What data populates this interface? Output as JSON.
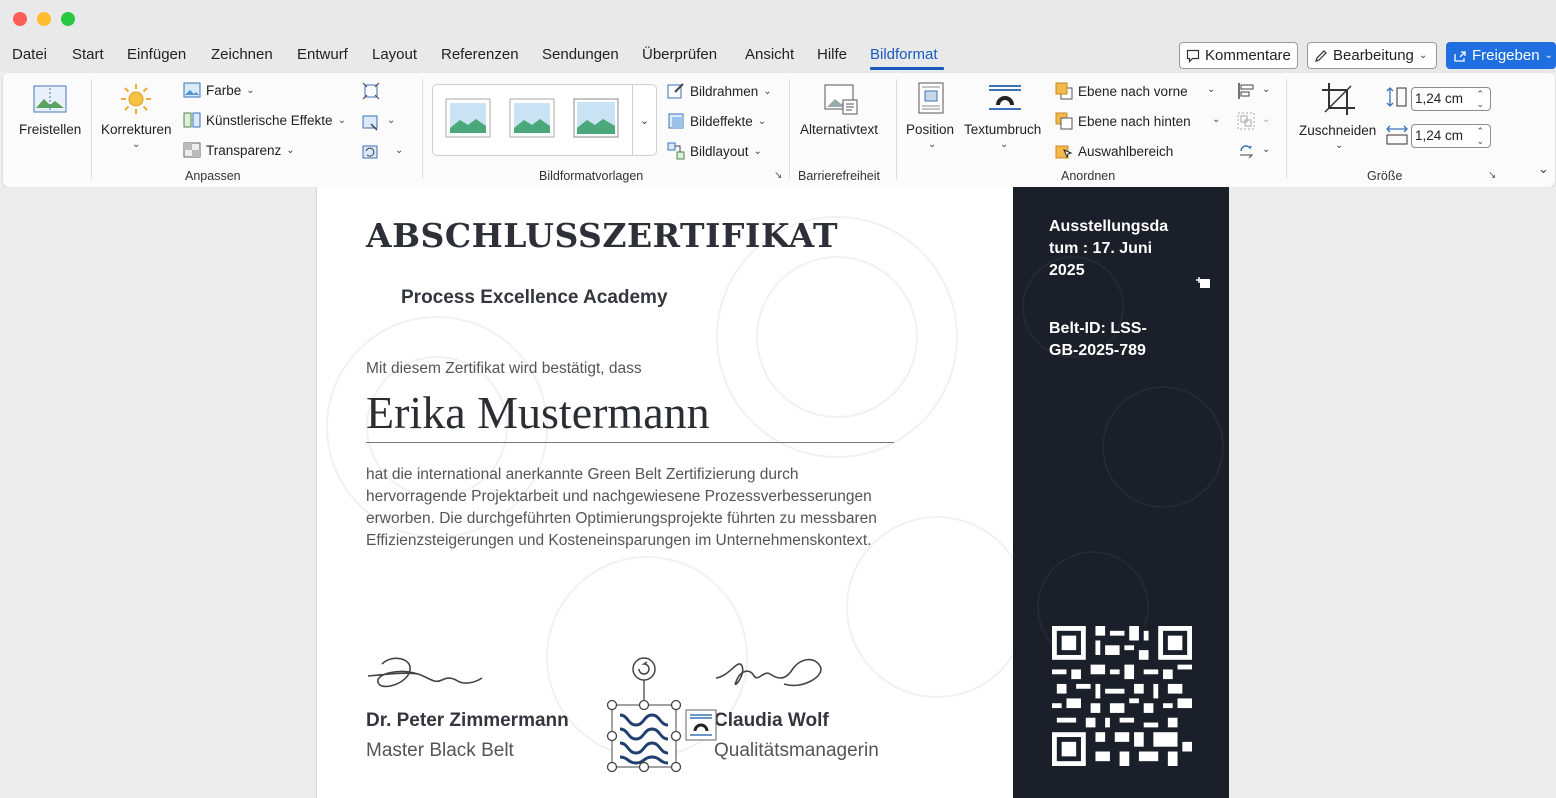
{
  "menu": {
    "items": [
      "Datei",
      "Start",
      "Einfügen",
      "Zeichnen",
      "Entwurf",
      "Layout",
      "Referenzen",
      "Sendungen",
      "Überprüfen",
      "Ansicht",
      "Hilfe",
      "Bildformat"
    ],
    "active": "Bildformat"
  },
  "top_buttons": {
    "comments": "Kommentare",
    "editing": "Bearbeitung",
    "share": "Freigeben"
  },
  "ribbon": {
    "freistellen": "Freistellen",
    "korrekturen": "Korrekturen",
    "farbe": "Farbe",
    "kuenstlerisch": "Künstlerische Effekte",
    "transparenz": "Transparenz",
    "group_anpassen": "Anpassen",
    "group_bildformatvorlagen": "Bildformatvorlagen",
    "bildrahmen": "Bildrahmen",
    "bildeffekte": "Bildeffekte",
    "bildlayout": "Bildlayout",
    "alternativtext": "Alternativtext",
    "group_barrierefreiheit": "Barrierefreiheit",
    "position": "Position",
    "textumbruch": "Textumbruch",
    "ebene_vorne": "Ebene nach vorne",
    "ebene_hinten": "Ebene nach hinten",
    "auswahlbereich": "Auswahlbereich",
    "group_anordnen": "Anordnen",
    "zuschneiden": "Zuschneiden",
    "height_value": "1,24 cm",
    "width_value": "1,24 cm",
    "group_groesse": "Größe"
  },
  "document": {
    "title": "ABSCHLUSSZERTIFIKAT",
    "academy": "Process Excellence Academy",
    "intro": "Mit diesem Zertifikat wird bestätigt, dass",
    "recipient": "Erika Mustermann",
    "body": "hat die international anerkannte Green Belt Zertifizierung durch hervorragende Projektarbeit und nachgewiesene Prozessverbesserungen erworben. Die durchgeführten Optimierungsprojekte führten zu messbaren Effizienzsteigerungen und Kosteneinsparungen im Unternehmenskontext.",
    "signer1_name": "Dr. Peter Zimmermann",
    "signer1_role": "Master Black Belt",
    "signer2_name": "Claudia Wolf",
    "signer2_role": "Qualitätsmanagerin",
    "date_line1": "Ausstellungsda",
    "date_line2": "tum : 17. Juni",
    "date_line3": "2025",
    "belt_line1": "Belt-ID: LSS-",
    "belt_line2": "GB-2025-789"
  },
  "colors": {
    "accent": "#185abd",
    "share_button": "#1f6fe0",
    "panel": "#1b1f29"
  }
}
